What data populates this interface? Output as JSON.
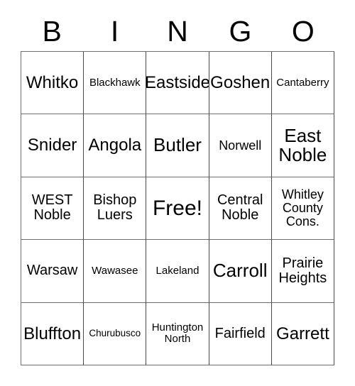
{
  "card": {
    "title": "BINGO",
    "header_letters": [
      "B",
      "I",
      "N",
      "G",
      "O"
    ],
    "free_space_label": "Free!",
    "colors": {
      "background": "#ffffff",
      "text": "#000000",
      "grid_line": "#4a4a4a"
    },
    "rows": [
      [
        {
          "text": "Whitko",
          "size": "lg"
        },
        {
          "text": "Blackhawk",
          "size": "xs"
        },
        {
          "text": "Eastside",
          "size": "lg"
        },
        {
          "text": "Goshen",
          "size": "lg"
        },
        {
          "text": "Cantaberry",
          "size": "xs"
        }
      ],
      [
        {
          "text": "Snider",
          "size": "lg"
        },
        {
          "text": "Angola",
          "size": "lg"
        },
        {
          "text": "Butler",
          "size": "xl"
        },
        {
          "text": "Norwell",
          "size": "sm"
        },
        {
          "text": "East\nNoble",
          "size": "xl"
        }
      ],
      [
        {
          "text": "WEST\nNoble",
          "size": "md"
        },
        {
          "text": "Bishop\nLuers",
          "size": "md"
        },
        {
          "text": "Free!",
          "size": "xxl"
        },
        {
          "text": "Central\nNoble",
          "size": "md"
        },
        {
          "text": "Whitley\nCounty\nCons.",
          "size": "sm"
        }
      ],
      [
        {
          "text": "Warsaw",
          "size": "md"
        },
        {
          "text": "Wawasee",
          "size": "xs"
        },
        {
          "text": "Lakeland",
          "size": "xs"
        },
        {
          "text": "Carroll",
          "size": "xl"
        },
        {
          "text": "Prairie\nHeights",
          "size": "md"
        }
      ],
      [
        {
          "text": "Bluffton",
          "size": "lg"
        },
        {
          "text": "Churubusco",
          "size": "xxs"
        },
        {
          "text": "Huntington\nNorth",
          "size": "xs"
        },
        {
          "text": "Fairfield",
          "size": "md"
        },
        {
          "text": "Garrett",
          "size": "lg"
        }
      ]
    ]
  }
}
